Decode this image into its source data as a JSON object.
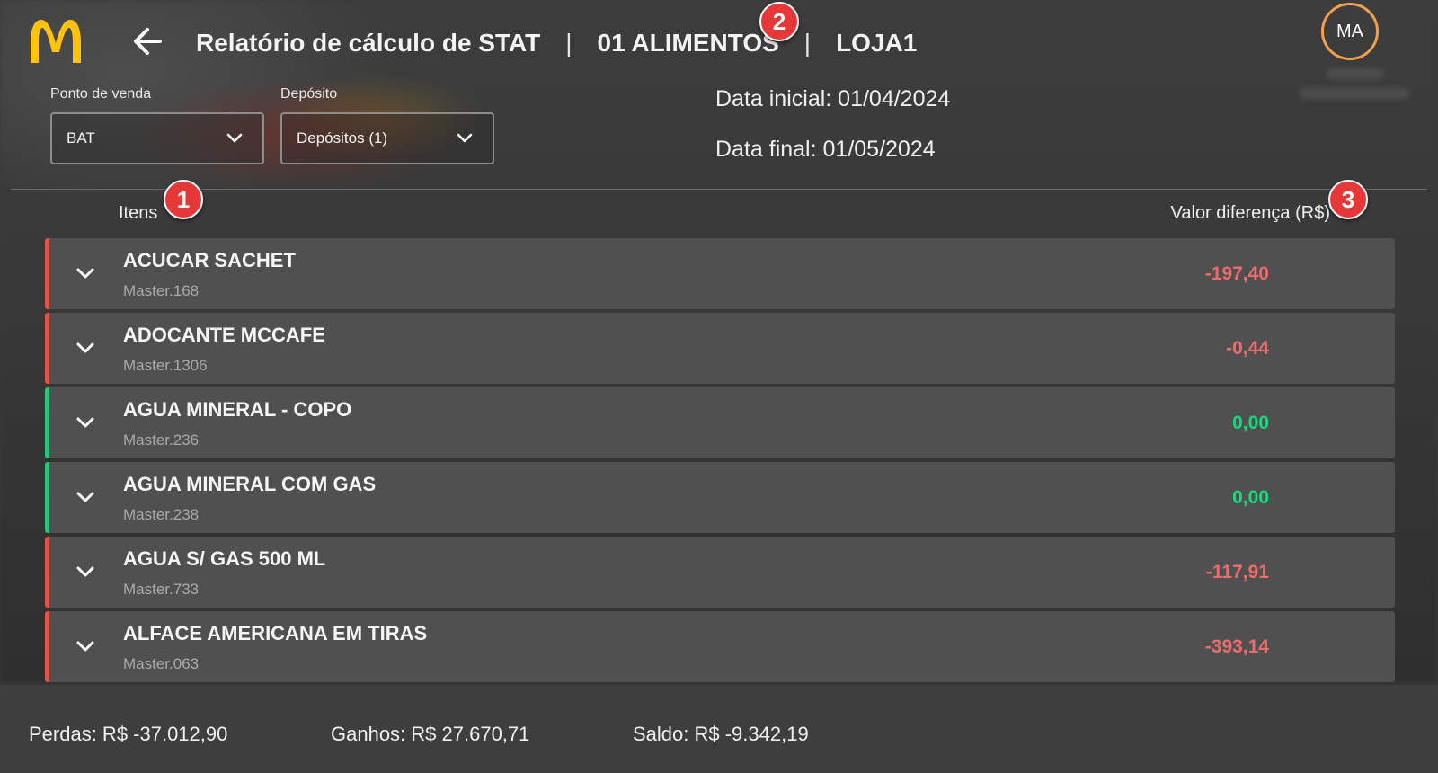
{
  "header": {
    "title": "Relatório de cálculo de STAT",
    "separator": "|",
    "category": "01 ALIMENTOS",
    "store": "LOJA1",
    "avatar_initials": "MA"
  },
  "filters": {
    "point_of_sale_label": "Ponto de venda",
    "point_of_sale_value": "BAT",
    "deposit_label": "Depósito",
    "deposit_value": "Depósitos (1)"
  },
  "dates": {
    "start": "Data inicial: 01/04/2024",
    "end": "Data final: 01/05/2024"
  },
  "table": {
    "items_header": "Itens",
    "value_header": "Valor diferença (R$)",
    "rows": [
      {
        "name": "ACUCAR SACHET",
        "code": "Master.168",
        "value": "-197,40",
        "status": "negative"
      },
      {
        "name": "ADOCANTE MCCAFE",
        "code": "Master.1306",
        "value": "-0,44",
        "status": "negative"
      },
      {
        "name": "AGUA MINERAL - COPO",
        "code": "Master.236",
        "value": "0,00",
        "status": "positive"
      },
      {
        "name": "AGUA MINERAL COM GAS",
        "code": "Master.238",
        "value": "0,00",
        "status": "positive"
      },
      {
        "name": "AGUA S/ GAS 500 ML",
        "code": "Master.733",
        "value": "-117,91",
        "status": "negative"
      },
      {
        "name": "ALFACE AMERICANA EM TIRAS",
        "code": "Master.063",
        "value": "-393,14",
        "status": "negative"
      }
    ]
  },
  "badges": {
    "one": "1",
    "two": "2",
    "three": "3"
  },
  "footer": {
    "losses": "Perdas: R$ -37.012,90",
    "gains": "Ganhos: R$ 27.670,71",
    "balance": "Saldo: R$ -9.342,19"
  },
  "colors": {
    "negative": "#ee6b6b",
    "positive": "#19d87e",
    "brand_yellow": "#ffc20e",
    "avatar_ring": "#f0a04c",
    "badge_red": "#e63838"
  },
  "icons": {
    "logo": "mcdonalds-arches-logo",
    "back": "arrow-left-icon",
    "dropdown": "chevron-down-icon",
    "expand": "chevron-down-icon"
  }
}
